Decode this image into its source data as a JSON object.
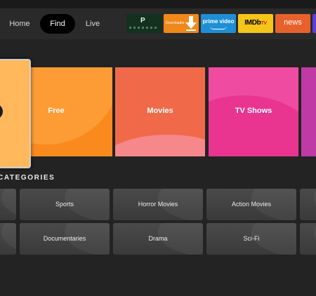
{
  "nav": {
    "home": "Home",
    "find": "Find",
    "live": "Live"
  },
  "apps": [
    {
      "name": "gplay",
      "label": "P"
    },
    {
      "name": "downloader",
      "label": "Downloader"
    },
    {
      "name": "prime-video",
      "label": "prime video"
    },
    {
      "name": "imdb-tv",
      "label": "IMDb",
      "suffix": "TV"
    },
    {
      "name": "news",
      "label": "news"
    }
  ],
  "hero": {
    "tiles": [
      "Free",
      "Movies",
      "TV Shows"
    ]
  },
  "categories": {
    "title": "CATEGORIES",
    "row1": [
      "Sports",
      "Horror Movies",
      "Action Movies"
    ],
    "row2": [
      "Documentaries",
      "Drama",
      "Sci-Fi"
    ]
  },
  "colors": {
    "background": "#232323",
    "nav_active": "#000000",
    "free_tile": "#fb8a1e",
    "movies_tile": "#f06a4a",
    "tv_tile": "#ef4ba1",
    "downloader": "#f0891a",
    "prime": "#1e8fd6",
    "imdb": "#f5c518",
    "news": "#e8612c"
  }
}
